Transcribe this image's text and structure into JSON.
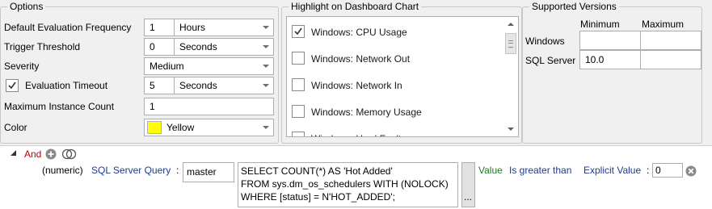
{
  "options": {
    "title": "Options",
    "default_eval_freq": {
      "label": "Default Evaluation Frequency",
      "value": "1",
      "unit": "Hours"
    },
    "trigger_threshold": {
      "label": "Trigger Threshold",
      "value": "0",
      "unit": "Seconds"
    },
    "severity": {
      "label": "Severity",
      "value": "Medium"
    },
    "evaluation_timeout": {
      "label": "Evaluation Timeout",
      "checked": true,
      "value": "5",
      "unit": "Seconds"
    },
    "max_instance_count": {
      "label": "Maximum Instance Count",
      "value": "1"
    },
    "color": {
      "label": "Color",
      "value": "Yellow",
      "swatch": "#ffff00"
    }
  },
  "highlight": {
    "title": "Highlight on Dashboard Chart",
    "items": [
      {
        "label": "Windows: CPU Usage",
        "checked": true
      },
      {
        "label": "Windows: Network Out",
        "checked": false
      },
      {
        "label": "Windows: Network In",
        "checked": false
      },
      {
        "label": "Windows: Memory Usage",
        "checked": false
      },
      {
        "label": "Windows: Hard Faults",
        "checked": false
      }
    ]
  },
  "versions": {
    "title": "Supported Versions",
    "col_min": "Minimum",
    "col_max": "Maximum",
    "rows": [
      {
        "label": "Windows",
        "min": "",
        "max": ""
      },
      {
        "label": "SQL Server",
        "min": "10.0",
        "max": ""
      }
    ]
  },
  "condition": {
    "and_label": "And",
    "type_prefix": "(numeric)",
    "query_label": "SQL Server Query",
    "colon": ":",
    "database": "master",
    "sql_lines": [
      "SELECT COUNT(*) AS 'Hot Added'",
      "FROM sys.dm_os_schedulers WITH (NOLOCK)",
      "WHERE [status] = N'HOT_ADDED';"
    ],
    "ellipsis": "...",
    "value_label": "Value",
    "operator": "Is greater than",
    "explicit_label": "Explicit Value",
    "explicit_value": "0"
  },
  "colors": {
    "link_blue": "#1b3b8f",
    "value_green": "#1e7a1e",
    "and_red": "#c00000",
    "swatch_yellow": "#ffff00"
  }
}
